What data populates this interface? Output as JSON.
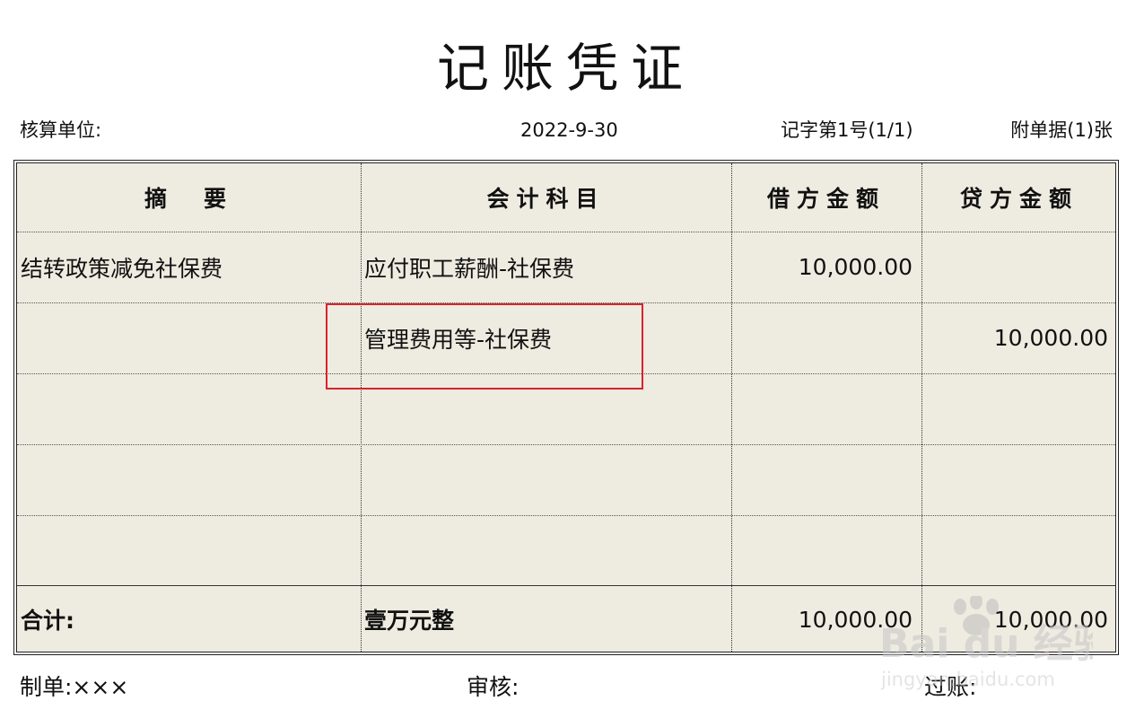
{
  "voucher": {
    "title": "记账凭证",
    "unit_label": "核算单位:",
    "date": "2022-9-30",
    "voucher_no": "记字第1号(1/1)",
    "attachments": "附单据(1)张"
  },
  "table": {
    "headers": {
      "summary": "摘　要",
      "account": "会计科目",
      "debit": "借方金额",
      "credit": "贷方金额"
    },
    "rows": [
      {
        "summary": "结转政策减免社保费",
        "account": "应付职工薪酬-社保费",
        "debit": "10,000.00",
        "credit": ""
      },
      {
        "summary": "",
        "account": "管理费用等-社保费",
        "debit": "",
        "credit": "10,000.00"
      },
      {
        "summary": "",
        "account": "",
        "debit": "",
        "credit": ""
      },
      {
        "summary": "",
        "account": "",
        "debit": "",
        "credit": ""
      },
      {
        "summary": "",
        "account": "",
        "debit": "",
        "credit": ""
      }
    ],
    "total": {
      "label": "合计:",
      "amount_in_words": "壹万元整",
      "debit": "10,000.00",
      "credit": "10,000.00"
    }
  },
  "footer": {
    "maker": "制单:×××",
    "auditor": "审核:",
    "poster": "过账:"
  },
  "watermark": {
    "brand": "Bai du 经验",
    "url": "jingyan.baidu.com"
  },
  "colors": {
    "table_bg": "#eeebe0",
    "highlight": "#d9232d"
  }
}
